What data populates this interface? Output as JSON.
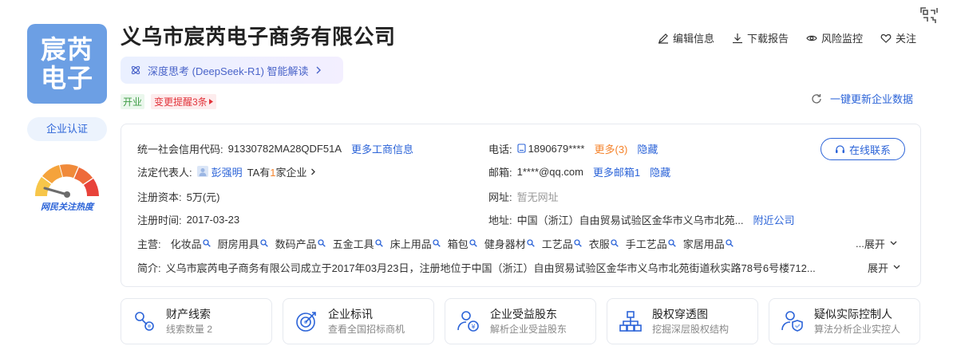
{
  "company": {
    "name": "义乌市宸芮电子商务有限公司",
    "logo_line1": "宸芮",
    "logo_line2": "电子",
    "cert_label": "企业认证",
    "heat_label": "网民关注热度",
    "ai_label": "深度思考 (DeepSeek-R1) 智能解读",
    "status_tag": "开业",
    "alert_tag": "变更提醒3条"
  },
  "actions": {
    "edit": "编辑信息",
    "download": "下载报告",
    "monitor": "风险监控",
    "follow": "关注"
  },
  "refresh_label": "一键更新企业数据",
  "info": {
    "credit_code_label": "统一社会信用代码:",
    "credit_code": "91330782MA28QDF51A",
    "more_business": "更多工商信息",
    "phone_label": "电话:",
    "phone": "1890679****",
    "more_phone": "更多(3)",
    "hide": "隐藏",
    "contact_btn": "在线联系",
    "legal_rep_label": "法定代表人:",
    "legal_rep": "彭强明",
    "ta_has_prefix": "TA有",
    "ta_has_count": "1",
    "ta_has_suffix": "家企业",
    "email_label": "邮箱:",
    "email": "1****@qq.com",
    "more_email": "更多邮箱1",
    "capital_label": "注册资本:",
    "capital": "5万(元)",
    "website_label": "网址:",
    "website": "暂无网址",
    "reg_date_label": "注册时间:",
    "reg_date": "2017-03-23",
    "address_label": "地址:",
    "address": "中国（浙江）自由贸易试验区金华市义乌市北苑...",
    "nearby": "附近公司",
    "main_label": "主营:",
    "main_items": [
      "化妆品",
      "厨房用具",
      "数码产品",
      "五金工具",
      "床上用品",
      "箱包",
      "健身器材",
      "工艺品",
      "衣服",
      "手工艺品",
      "家居用品"
    ],
    "main_ellipsis": "...",
    "expand": "展开",
    "intro_label": "简介:",
    "intro": "义乌市宸芮电子商务有限公司成立于2017年03月23日，注册地位于中国（浙江）自由贸易试验区金华市义乌市北苑街道秋实路78号6号楼712..."
  },
  "features": [
    {
      "title": "财产线索",
      "sub": "线索数量 2",
      "icon": "wealth-clue-icon"
    },
    {
      "title": "企业标讯",
      "sub": "查看全国招标商机",
      "icon": "target-icon"
    },
    {
      "title": "企业受益股东",
      "sub": "解析企业受益股东",
      "icon": "shareholder-icon"
    },
    {
      "title": "股权穿透图",
      "sub": "挖掘深层股权结构",
      "icon": "org-chart-icon"
    },
    {
      "title": "疑似实际控制人",
      "sub": "算法分析企业实控人",
      "icon": "controller-icon"
    }
  ],
  "colors": {
    "accent": "#2c64d8",
    "logo_bg": "#6c9fe4",
    "status_green": "#3f9d46",
    "alert_red": "#e2343b",
    "orange": "#f5832b"
  }
}
